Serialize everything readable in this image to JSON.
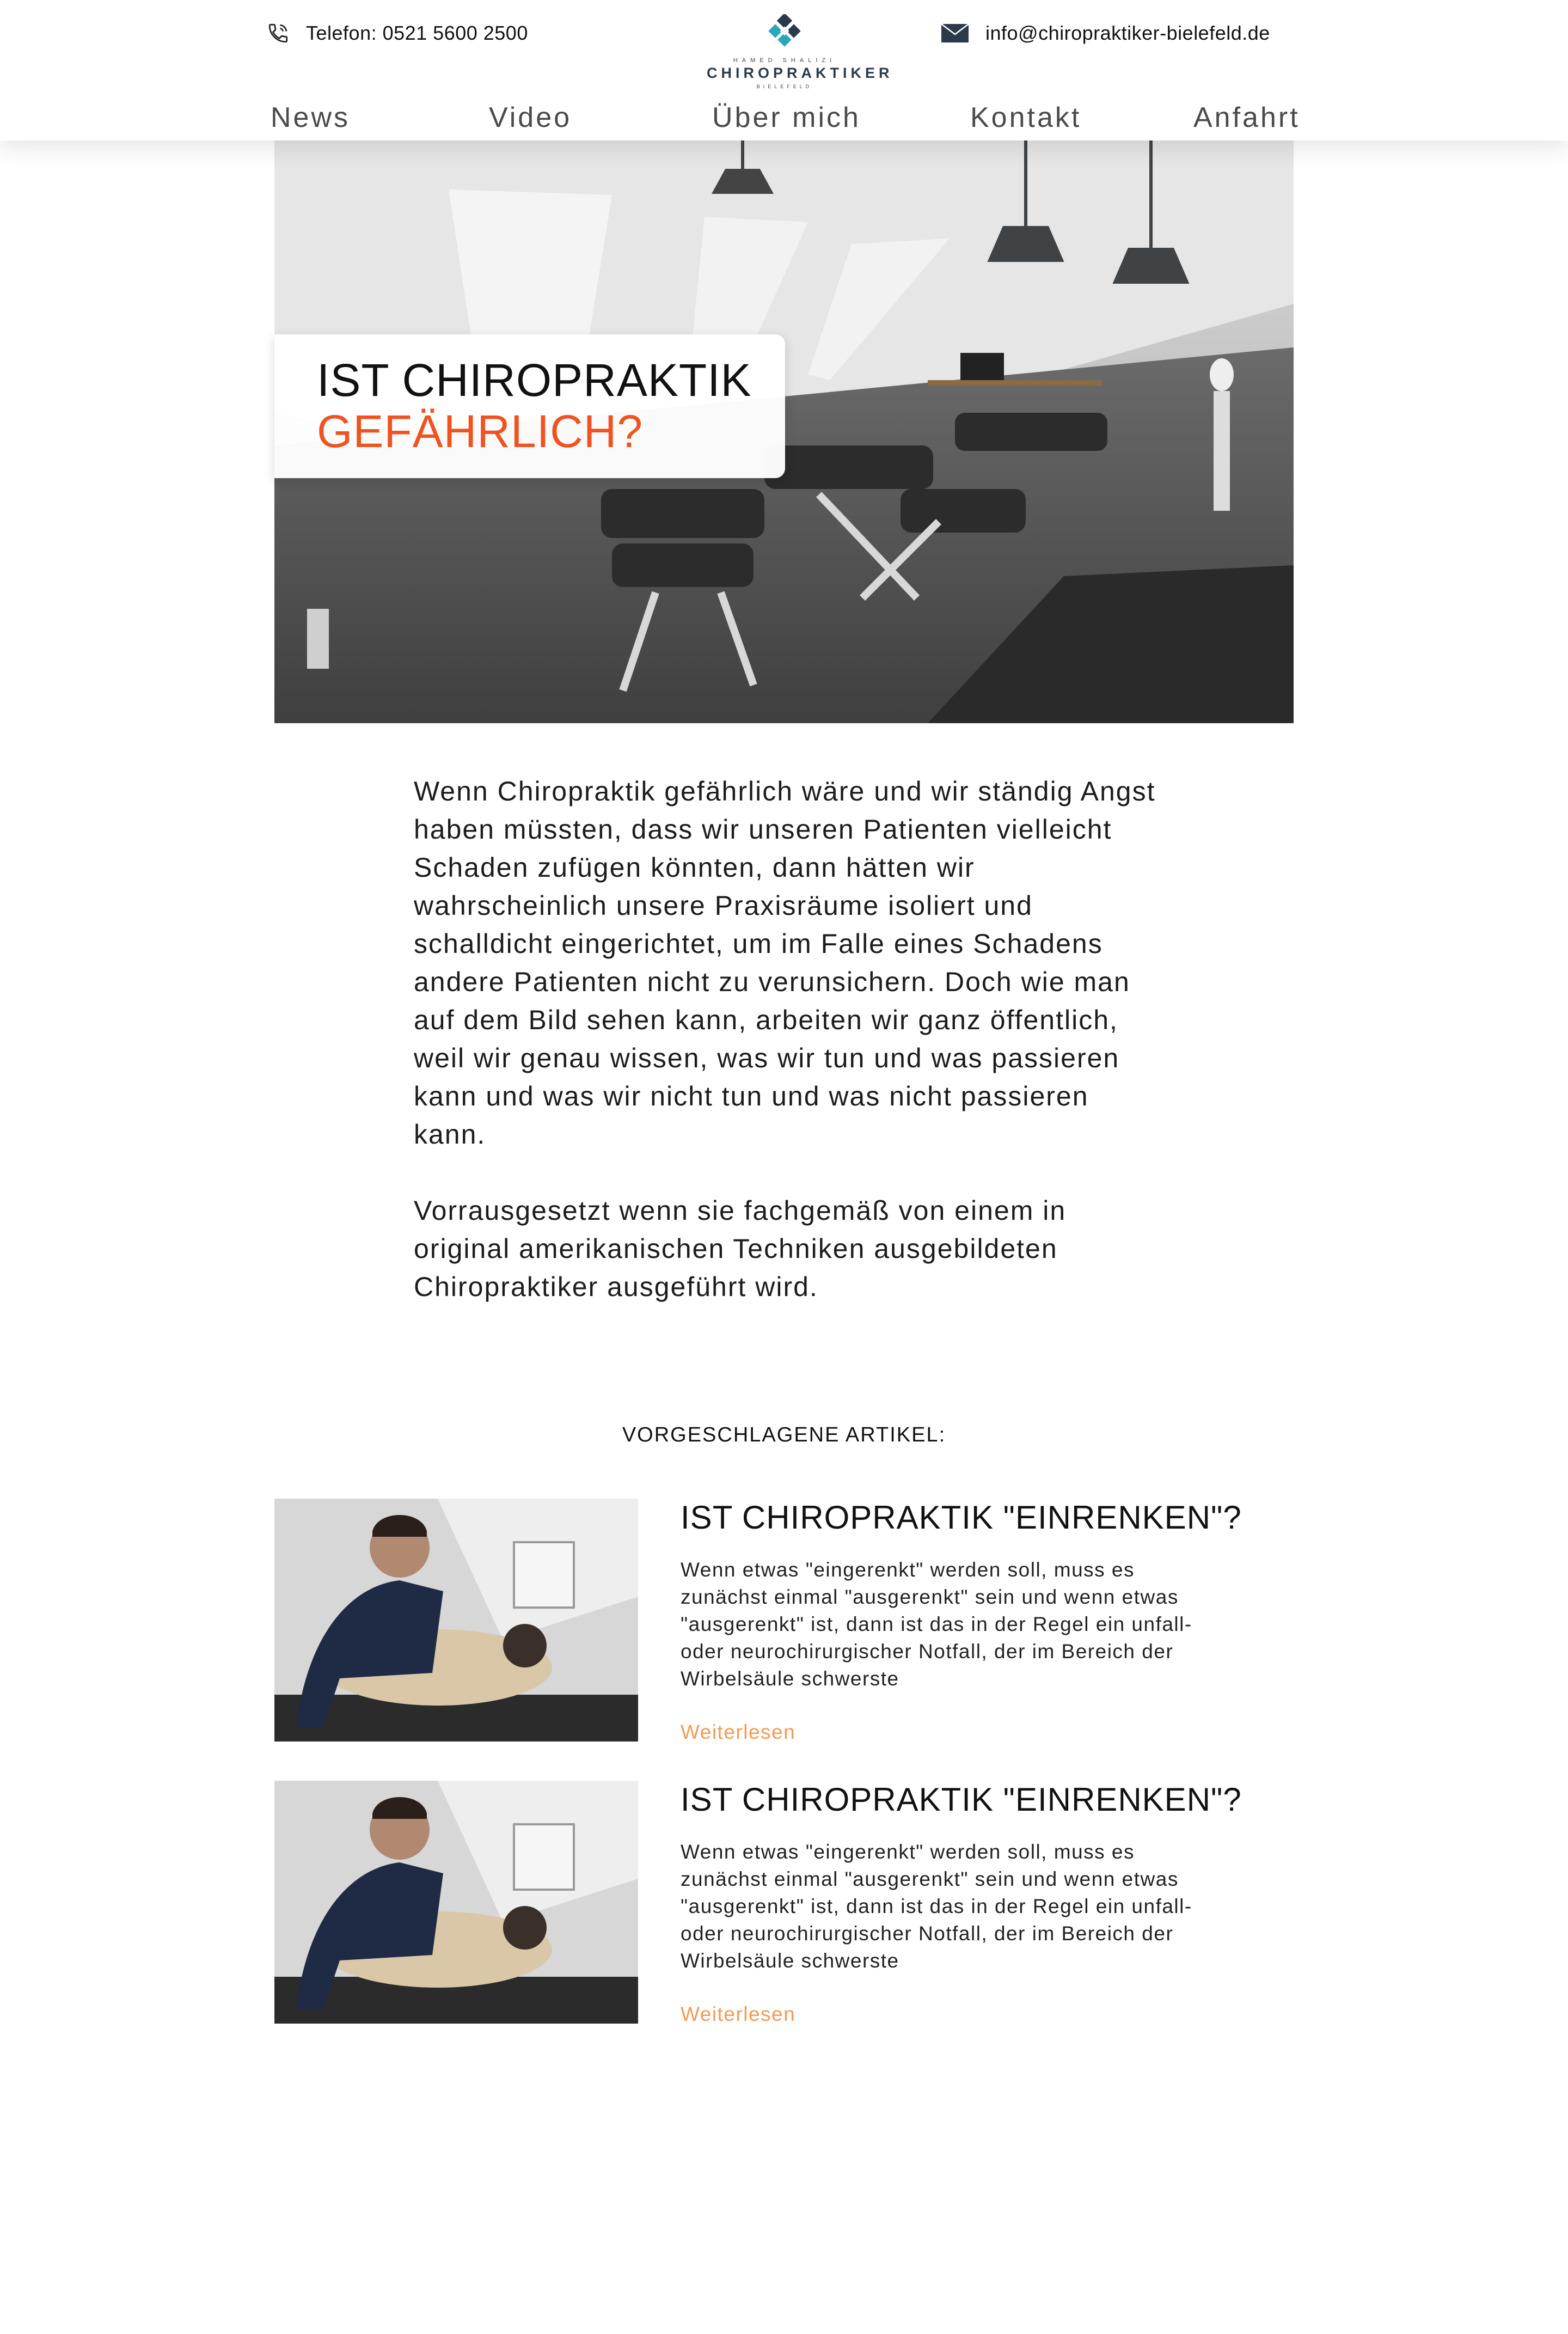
{
  "header": {
    "phone_label": "Telefon: 0521 5600 2500",
    "email_label": "info@chiropraktiker-bielefeld.de",
    "logo": {
      "top_line": "HAMED SHALIZI",
      "main": "CHIROPRAKTIKER",
      "bottom_line": "BIELEFELD"
    },
    "nav": [
      "News",
      "Video",
      "Über mich",
      "Kontakt",
      "Anfahrt"
    ]
  },
  "hero": {
    "title_line1": "IST CHIROPRAKTIK",
    "title_line2": "GEFÄHRLICH?",
    "accent_color": "#f0531f"
  },
  "article": {
    "paragraph1": "Wenn Chiropraktik gefährlich wäre und wir ständig Angst haben müssten, dass wir unseren Patienten vielleicht Schaden zufügen könnten, dann hätten wir wahrscheinlich unsere Praxisräume isoliert und schalldicht eingerichtet, um im Falle eines Schadens andere Patienten nicht zu verunsichern. Doch wie man auf dem Bild sehen kann, arbeiten wir ganz öffentlich, weil wir genau wissen, was wir tun und was passieren kann und was wir nicht tun und was nicht passieren kann.",
    "paragraph2": "Vorrausgesetzt wenn sie fachgemäß von einem in original amerikanischen Techniken ausgebildeten Chiropraktiker ausgeführt wird."
  },
  "suggested": {
    "heading": "VORGESCHLAGENE ARTIKEL:",
    "items": [
      {
        "title": "IST CHIROPRAKTIK \"EINRENKEN\"?",
        "excerpt": "Wenn etwas \"eingerenkt\" werden soll, muss es zunächst einmal \"ausgerenkt\" sein und wenn etwas \"ausgerenkt\" ist, dann ist das in der Regel ein unfall- oder neurochirurgischer Notfall, der im Bereich der Wirbelsäule schwerste",
        "link": "Weiterlesen"
      },
      {
        "title": "IST CHIROPRAKTIK \"EINRENKEN\"?",
        "excerpt": "Wenn etwas \"eingerenkt\" werden soll, muss es zunächst einmal \"ausgerenkt\" sein und wenn etwas \"ausgerenkt\" ist, dann ist das in der Regel ein unfall- oder neurochirurgischer Notfall, der im Bereich der Wirbelsäule schwerste",
        "link": "Weiterlesen"
      }
    ],
    "link_color": "#f39a55"
  }
}
